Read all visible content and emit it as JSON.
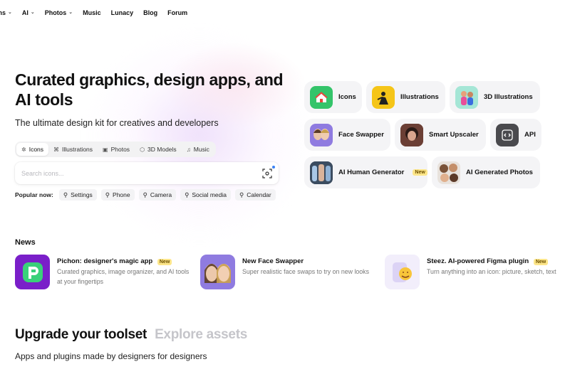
{
  "nav": {
    "items": [
      {
        "label": "Icons",
        "has_dropdown": true
      },
      {
        "label": "AI",
        "has_dropdown": true
      },
      {
        "label": "Photos",
        "has_dropdown": true
      },
      {
        "label": "Music",
        "has_dropdown": false
      },
      {
        "label": "Lunacy",
        "has_dropdown": false
      },
      {
        "label": "Blog",
        "has_dropdown": false
      },
      {
        "label": "Forum",
        "has_dropdown": false
      }
    ],
    "first_visible": "ons"
  },
  "hero": {
    "title": "Curated graphics, design apps, and AI tools",
    "subtitle": "The ultimate design kit for creatives and developers"
  },
  "search_tabs": [
    {
      "label": "Icons",
      "icon": "icons-icon",
      "active": true
    },
    {
      "label": "Illustrations",
      "icon": "illustrations-icon",
      "active": false
    },
    {
      "label": "Photos",
      "icon": "photos-icon",
      "active": false
    },
    {
      "label": "3D Models",
      "icon": "cube-icon",
      "active": false
    },
    {
      "label": "Music",
      "icon": "music-note-icon",
      "active": false
    }
  ],
  "search": {
    "placeholder": "Search icons..."
  },
  "popular": {
    "label": "Popular now:",
    "chips": [
      "Settings",
      "Phone",
      "Camera",
      "Social media",
      "Calendar"
    ]
  },
  "tiles": {
    "icons": "Icons",
    "illustrations": "Illustrations",
    "illustrations_3d": "3D Illustrations",
    "face_swapper": "Face Swapper",
    "smart_upscaler": "Smart Upscaler",
    "api": "API",
    "ai_human_generator": "AI Human Generator",
    "ai_generated_photos": "AI Generated Photos",
    "new_badge": "New"
  },
  "news": {
    "title": "News",
    "items": [
      {
        "headline": "Pichon: designer's magic app",
        "new": true,
        "description": "Curated graphics, image organizer, and AI tools at your fingertips"
      },
      {
        "headline": "New Face Swapper",
        "new": false,
        "description": "Super realistic face swaps to try on new looks"
      },
      {
        "headline": "Steez. AI-powered Figma plugin",
        "new": true,
        "description": "Turn anything into an icon: picture, sketch, text"
      }
    ],
    "new_badge": "New"
  },
  "upgrade": {
    "title": "Upgrade your toolset",
    "secondary": "Explore assets",
    "subtitle": "Apps and plugins made by designers for designers"
  },
  "colors": {
    "icons_tile_green": "#34c46a",
    "pichon_purple": "#7a1fc9",
    "new_badge": "#fde68a",
    "face_swapper_bg": "#8f7be0"
  }
}
